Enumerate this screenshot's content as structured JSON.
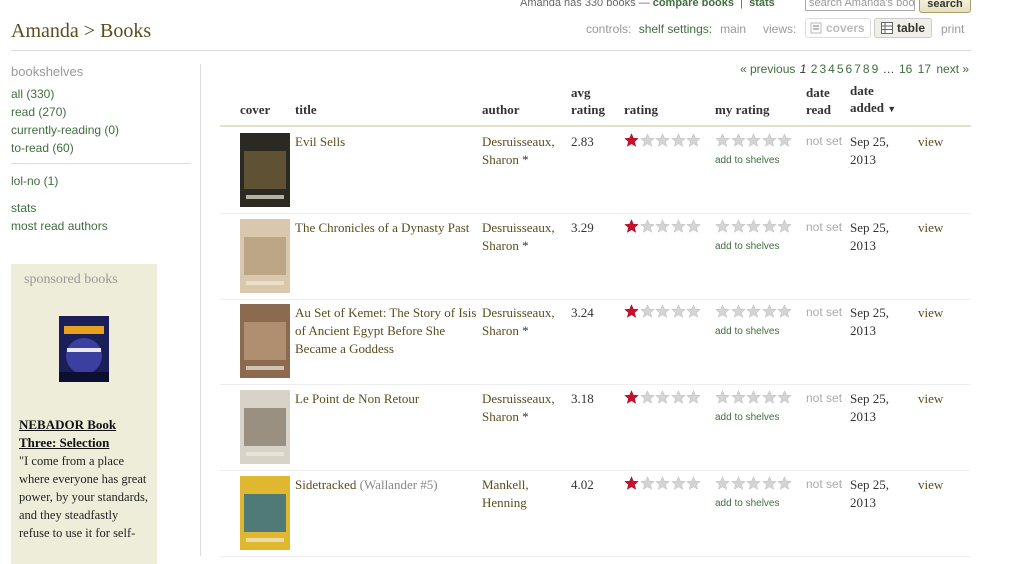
{
  "top": {
    "count_text": "Amanda has 330 books —",
    "compare_label": "compare books",
    "stats_label": "stats",
    "search_placeholder": "search Amanda's books",
    "search_button": "search"
  },
  "header": {
    "title": "Amanda > Books",
    "controls_label": "controls:",
    "shelf_settings_label": "shelf settings:",
    "shelf_settings_value": "main",
    "views_label": "views:",
    "covers_label": "covers",
    "table_label": "table",
    "print_label": "print"
  },
  "sidebar": {
    "header": "bookshelves",
    "shelves": [
      {
        "label": "all (330)",
        "color": "#3f6e3f"
      },
      {
        "label": "read (270)",
        "color": "#3f6e3f"
      },
      {
        "label": "currently-reading (0)",
        "color": "#3f6e3f"
      },
      {
        "label": "to-read (60)",
        "color": "#3f6e3f"
      }
    ],
    "custom_shelves": [
      {
        "label": "lol-no (1)"
      }
    ],
    "links": [
      {
        "label": "stats"
      },
      {
        "label": "most read authors"
      }
    ]
  },
  "sponsored": {
    "header": "sponsored books",
    "book_title": "NEBADOR Book Three: Selection",
    "blurb": "\"I come from a place where everyone has great power, by your standards, and they steadfastly refuse to use it for self-"
  },
  "pagination": {
    "previous": "« previous",
    "current": "1",
    "pages": [
      "2",
      "3",
      "4",
      "5",
      "6",
      "7",
      "8",
      "9"
    ],
    "ellipsis": "…",
    "last_pages": [
      "16",
      "17"
    ],
    "next": "next »"
  },
  "table": {
    "headers": {
      "cover": "cover",
      "title": "title",
      "author": "author",
      "avg_rating": "avg rating",
      "rating": "rating",
      "my_rating": "my rating",
      "date_read": "date read",
      "date_added": "date added"
    },
    "sort_indicator": "▼",
    "add_to_shelves": "add to shelves",
    "not_set": "not set",
    "view_label": "view",
    "rows": [
      {
        "title": "Evil Sells",
        "series": "",
        "author": "Desruisseaux, Sharon",
        "author_star": "*",
        "avg": "2.83",
        "rating": 1,
        "date_added": "Sep 25, 2013",
        "cover_colors": [
          "#2b2a22",
          "#6b5b3a"
        ]
      },
      {
        "title": "The Chronicles of a Dynasty Past",
        "series": "",
        "author": "Desruisseaux, Sharon",
        "author_star": "*",
        "avg": "3.29",
        "rating": 1,
        "date_added": "Sep 25, 2013",
        "cover_colors": [
          "#d9c8ad",
          "#b59d7a"
        ]
      },
      {
        "title": "Au Set of Kemet: The Story of Isis of Ancient Egypt Before She Became a Goddess",
        "series": "",
        "author": "Desruisseaux, Sharon",
        "author_star": "*",
        "avg": "3.24",
        "rating": 1,
        "date_added": "Sep 25, 2013",
        "cover_colors": [
          "#8b6a4f",
          "#b89878"
        ]
      },
      {
        "title": "Le Point de Non Retour",
        "series": "",
        "author": "Desruisseaux, Sharon",
        "author_star": "*",
        "avg": "3.18",
        "rating": 1,
        "date_added": "Sep 25, 2013",
        "cover_colors": [
          "#d8d3c8",
          "#8a8070"
        ]
      },
      {
        "title": "Sidetracked",
        "series": "(Wallander #5)",
        "author": "Mankell, Henning",
        "author_star": "",
        "avg": "4.02",
        "rating": 1,
        "date_added": "Sep 25, 2013",
        "cover_colors": [
          "#e0b830",
          "#2a6a8a"
        ]
      }
    ]
  },
  "colors": {
    "accent_green": "#3f6e3f",
    "title_brown": "#5a4d1e",
    "star_red": "#c8102e",
    "star_empty": "#d4d4d4",
    "sponsor_bg": "#eeedd9"
  }
}
